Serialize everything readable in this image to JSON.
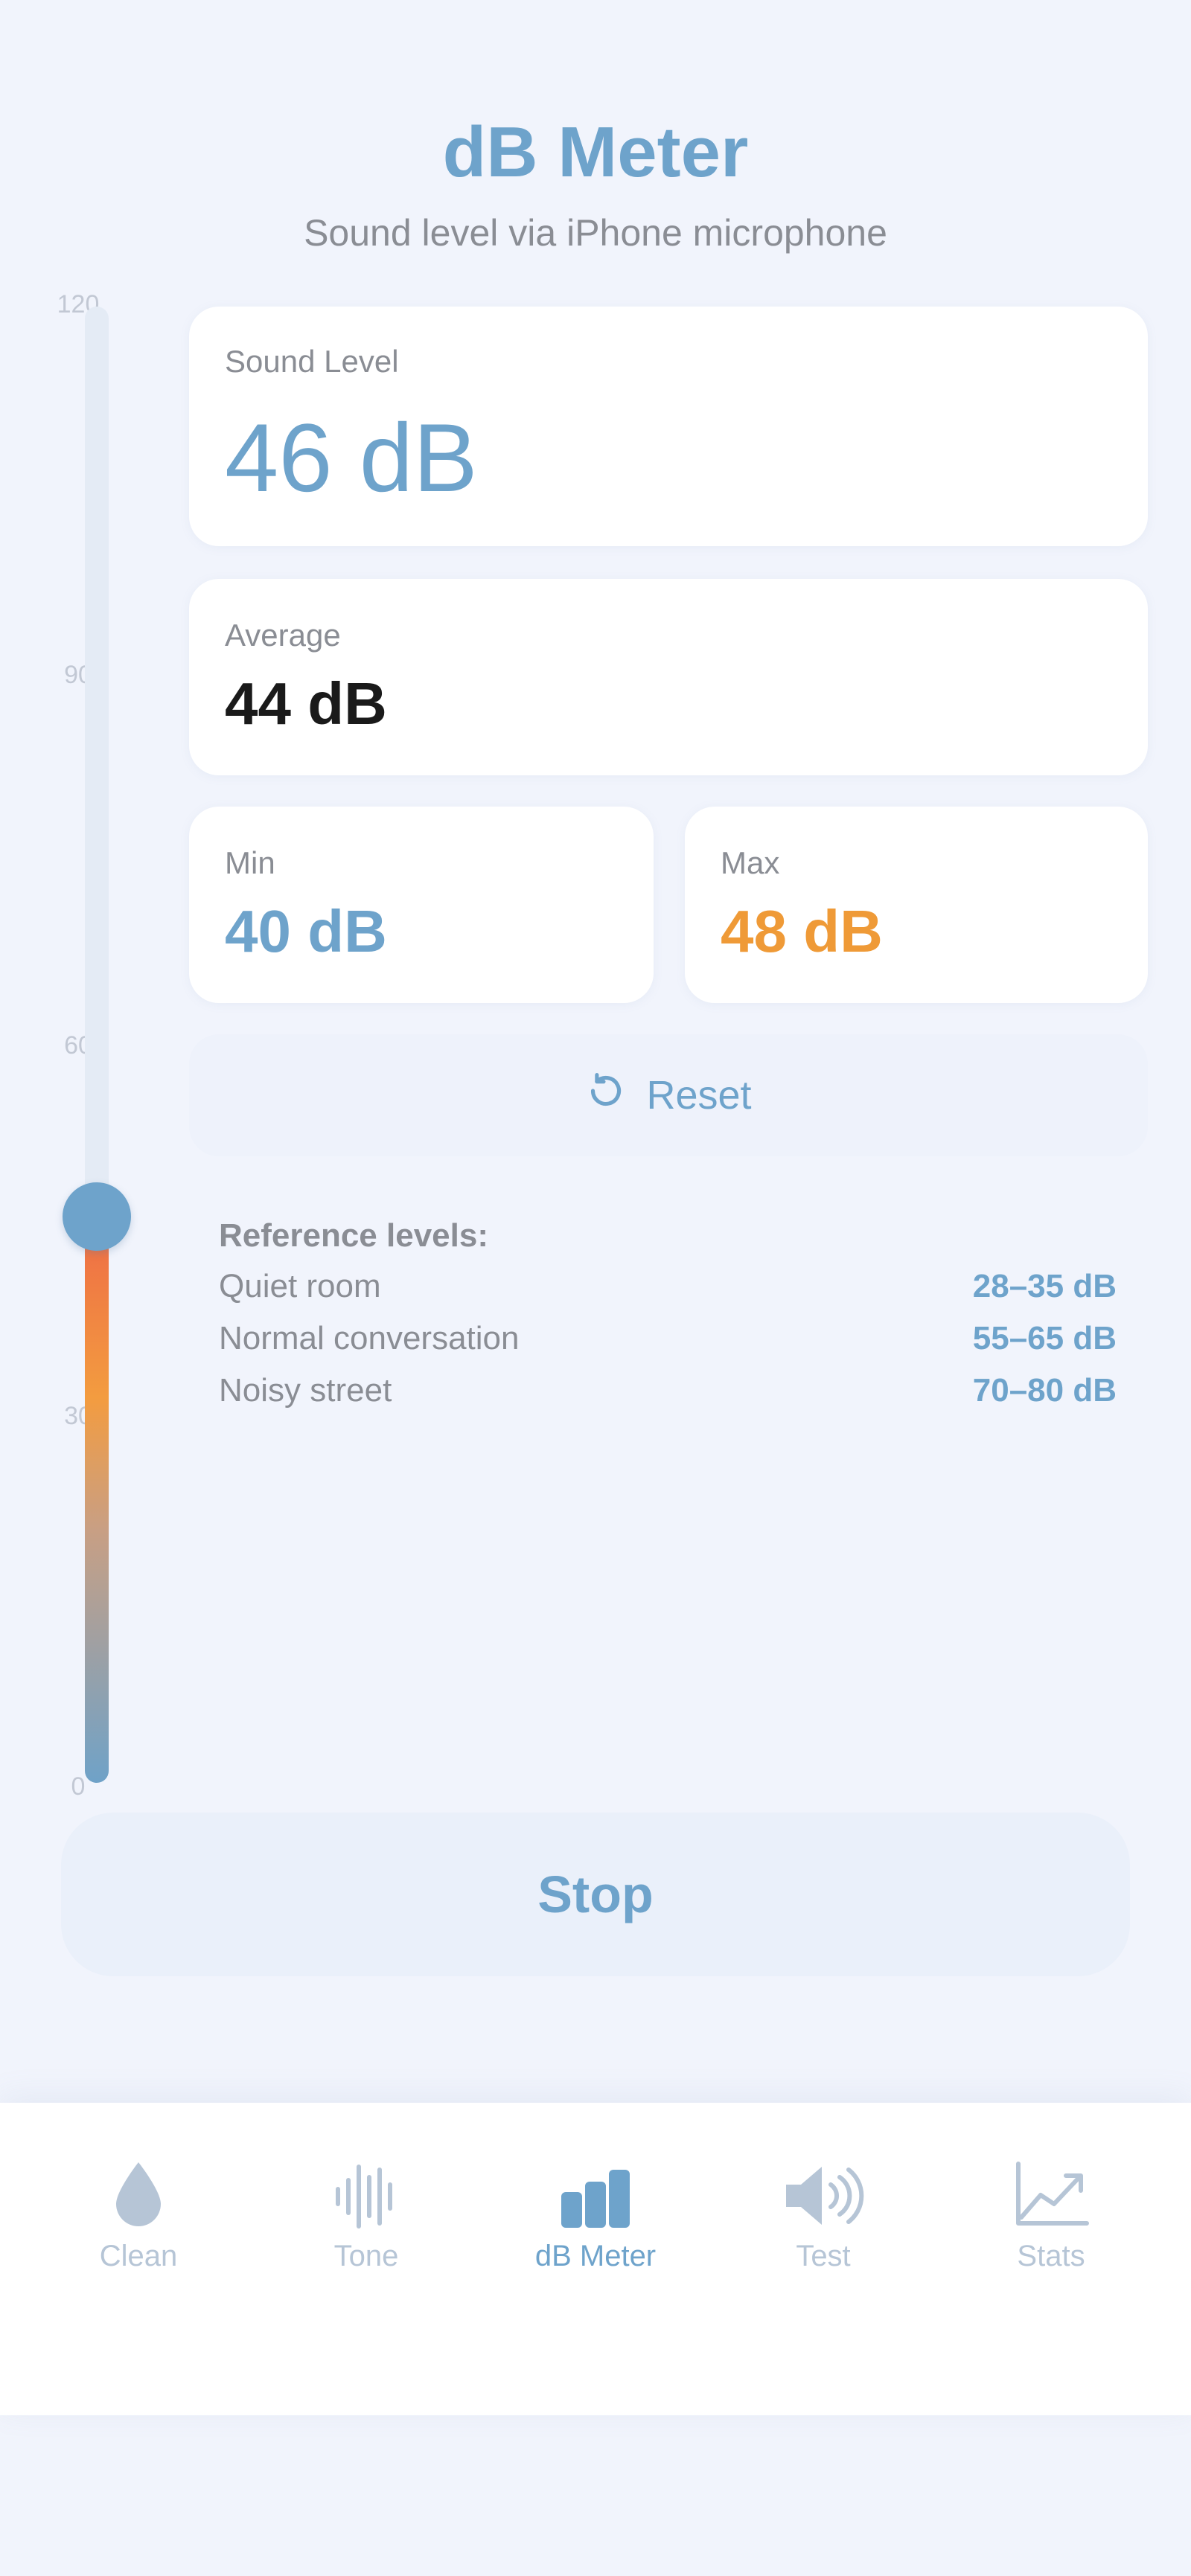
{
  "header": {
    "title": "dB Meter",
    "subtitle": "Sound level via iPhone microphone"
  },
  "meter": {
    "scale": [
      "120",
      "90",
      "60",
      "30",
      "0"
    ],
    "level_db": 46,
    "max_db": 120
  },
  "cards": {
    "sound_level": {
      "label": "Sound Level",
      "value": "46 dB"
    },
    "average": {
      "label": "Average",
      "value": "44 dB"
    },
    "min": {
      "label": "Min",
      "value": "40 dB"
    },
    "max": {
      "label": "Max",
      "value": "48 dB"
    }
  },
  "reset_label": "Reset",
  "reference": {
    "title": "Reference levels:",
    "rows": [
      {
        "name": "Quiet room",
        "range": "28–35 dB"
      },
      {
        "name": "Normal conversation",
        "range": "55–65 dB"
      },
      {
        "name": "Noisy street",
        "range": "70–80 dB"
      }
    ]
  },
  "stop_label": "Stop",
  "tabs": [
    {
      "label": "Clean",
      "icon": "drop-icon",
      "active": false
    },
    {
      "label": "Tone",
      "icon": "waveform-icon",
      "active": false
    },
    {
      "label": "dB Meter",
      "icon": "bar-chart-icon",
      "active": true
    },
    {
      "label": "Test",
      "icon": "speaker-wave-icon",
      "active": false
    },
    {
      "label": "Stats",
      "icon": "trend-chart-icon",
      "active": false
    }
  ],
  "colors": {
    "accent": "#6ea3cb",
    "max_orange": "#ef9a37",
    "text_dark": "#1a1a1a",
    "muted": "#8a8d94",
    "background": "#f1f4fc"
  }
}
